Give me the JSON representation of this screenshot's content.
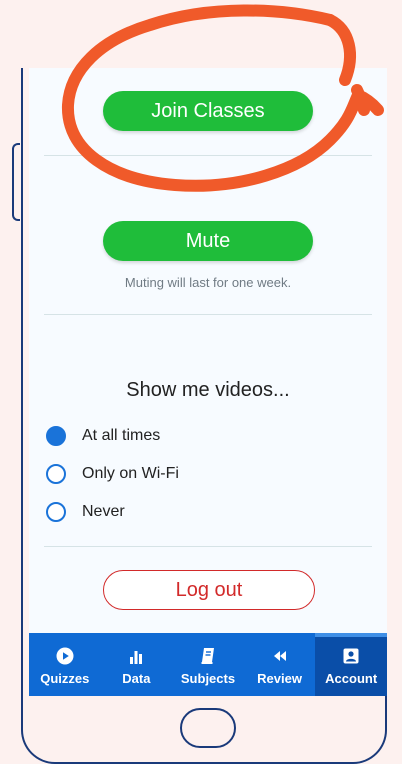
{
  "account": {
    "join_classes_label": "Join Classes",
    "mute_label": "Mute",
    "mute_caption": "Muting will last for one week.",
    "videos_heading": "Show me videos...",
    "video_options": [
      {
        "label": "At all times",
        "selected": true
      },
      {
        "label": "Only on Wi-Fi",
        "selected": false
      },
      {
        "label": "Never",
        "selected": false
      }
    ],
    "logout_label": "Log out"
  },
  "tabbar": {
    "tabs": [
      {
        "label": "Quizzes",
        "icon": "play-icon"
      },
      {
        "label": "Data",
        "icon": "bar-chart-icon"
      },
      {
        "label": "Subjects",
        "icon": "book-icon"
      },
      {
        "label": "Review",
        "icon": "rewind-icon"
      },
      {
        "label": "Account",
        "icon": "account-icon",
        "active": true
      }
    ]
  },
  "colors": {
    "accent_green": "#1fbd3a",
    "accent_blue": "#1a73d9",
    "tab_blue": "#0f6ad4",
    "logout_red": "#d22a2a",
    "annotation_orange": "#f05a2a"
  }
}
